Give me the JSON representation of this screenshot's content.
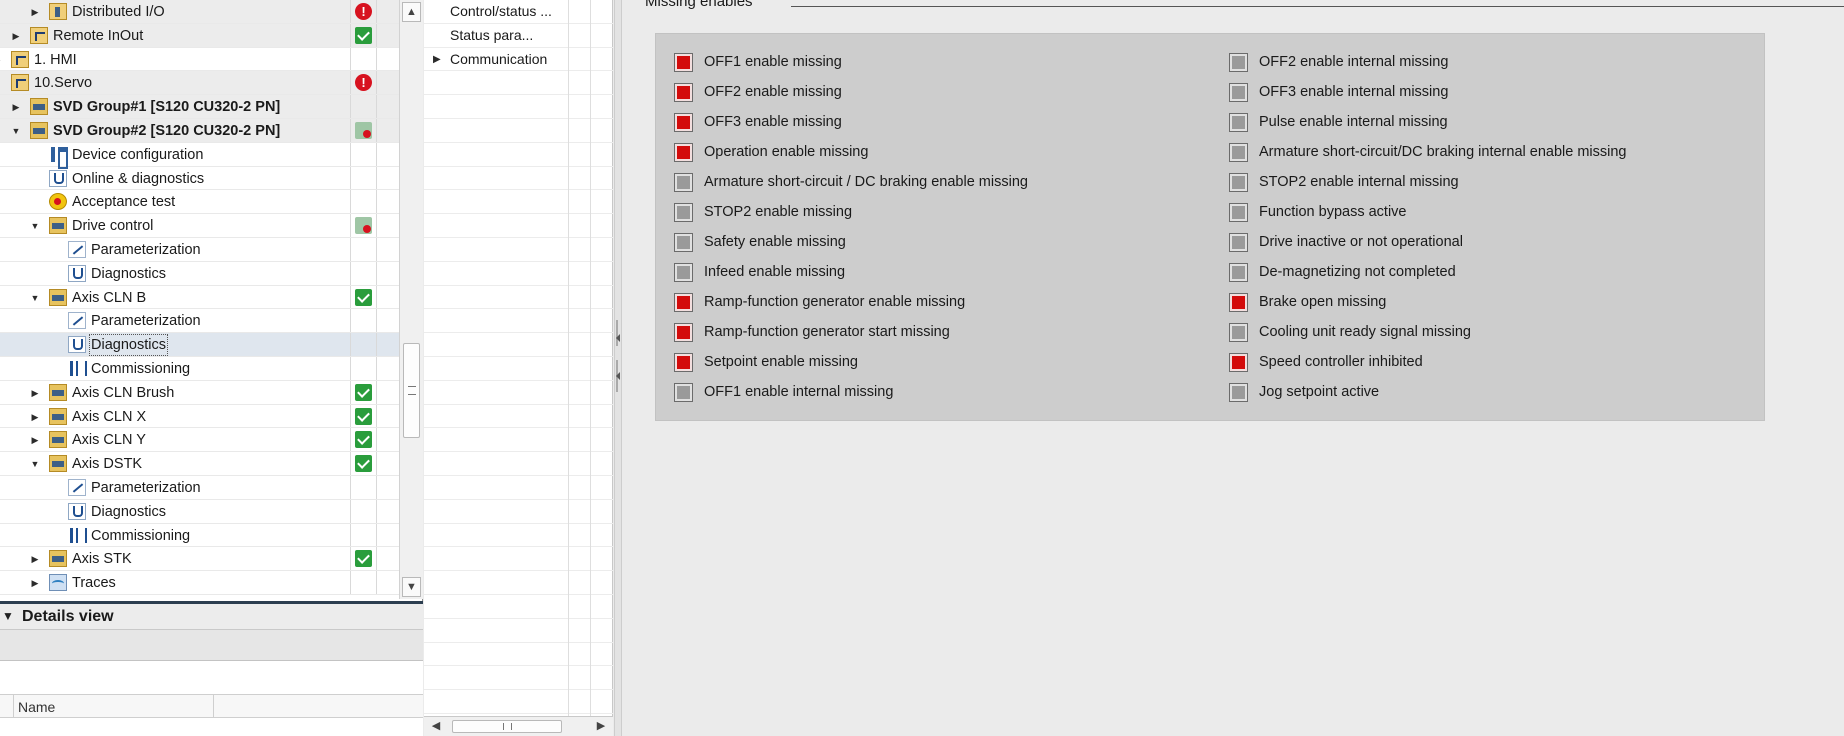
{
  "tree": {
    "rows": [
      {
        "label": "Distributed I/O",
        "indent": 3,
        "expander": "collapsed",
        "icon": "folder-io-icon",
        "status": "error",
        "bold": false
      },
      {
        "label": "Remote InOut",
        "indent": 2,
        "expander": "collapsed",
        "icon": "group-icon",
        "status": "ok",
        "bold": false
      },
      {
        "label": "1. HMI",
        "indent": 1,
        "expander": "collapsed",
        "icon": "group-icon",
        "status": "",
        "bold": false
      },
      {
        "label": "10.Servo",
        "indent": 1,
        "expander": "expanded",
        "icon": "group-icon",
        "status": "error",
        "bold": false
      },
      {
        "label": "SVD Group#1 [S120 CU320-2 PN]",
        "indent": 2,
        "expander": "collapsed",
        "icon": "drive-icon",
        "status": "",
        "bold": true
      },
      {
        "label": "SVD Group#2 [S120 CU320-2 PN]",
        "indent": 2,
        "expander": "expanded",
        "icon": "drive-icon",
        "status": "device",
        "bold": true
      },
      {
        "label": "Device configuration",
        "indent": 3,
        "expander": "",
        "icon": "device-config-icon",
        "status": "",
        "bold": false
      },
      {
        "label": "Online & diagnostics",
        "indent": 3,
        "expander": "",
        "icon": "online-diagnostics-icon",
        "status": "",
        "bold": false
      },
      {
        "label": "Acceptance test",
        "indent": 3,
        "expander": "",
        "icon": "acceptance-test-icon",
        "status": "",
        "bold": false
      },
      {
        "label": "Drive control",
        "indent": 3,
        "expander": "expanded",
        "icon": "drive-folder-icon",
        "status": "device",
        "bold": false
      },
      {
        "label": "Parameterization",
        "indent": 4,
        "expander": "",
        "icon": "parameterization-icon",
        "status": "",
        "bold": false
      },
      {
        "label": "Diagnostics",
        "indent": 4,
        "expander": "",
        "icon": "diagnostics-icon",
        "status": "",
        "bold": false
      },
      {
        "label": "Axis CLN B",
        "indent": 3,
        "expander": "expanded",
        "icon": "drive-folder-icon",
        "status": "ok",
        "bold": false
      },
      {
        "label": "Parameterization",
        "indent": 4,
        "expander": "",
        "icon": "parameterization-icon",
        "status": "",
        "bold": false
      },
      {
        "label": "Diagnostics",
        "indent": 4,
        "expander": "",
        "icon": "diagnostics-icon",
        "status": "",
        "bold": false,
        "selected": true
      },
      {
        "label": "Commissioning",
        "indent": 4,
        "expander": "",
        "icon": "commissioning-icon",
        "status": "",
        "bold": false
      },
      {
        "label": "Axis CLN Brush",
        "indent": 3,
        "expander": "collapsed",
        "icon": "drive-folder-icon",
        "status": "ok",
        "bold": false
      },
      {
        "label": "Axis CLN X",
        "indent": 3,
        "expander": "collapsed",
        "icon": "drive-folder-icon",
        "status": "ok",
        "bold": false
      },
      {
        "label": "Axis CLN Y",
        "indent": 3,
        "expander": "collapsed",
        "icon": "drive-folder-icon",
        "status": "ok",
        "bold": false
      },
      {
        "label": "Axis DSTK",
        "indent": 3,
        "expander": "expanded",
        "icon": "drive-folder-icon",
        "status": "ok",
        "bold": false
      },
      {
        "label": "Parameterization",
        "indent": 4,
        "expander": "",
        "icon": "parameterization-icon",
        "status": "",
        "bold": false
      },
      {
        "label": "Diagnostics",
        "indent": 4,
        "expander": "",
        "icon": "diagnostics-icon",
        "status": "",
        "bold": false
      },
      {
        "label": "Commissioning",
        "indent": 4,
        "expander": "",
        "icon": "commissioning-icon",
        "status": "",
        "bold": false
      },
      {
        "label": "Axis STK",
        "indent": 3,
        "expander": "collapsed",
        "icon": "drive-folder-icon",
        "status": "ok",
        "bold": false
      },
      {
        "label": "Traces",
        "indent": 3,
        "expander": "collapsed",
        "icon": "traces-icon",
        "status": "",
        "bold": false
      }
    ]
  },
  "details_view": {
    "title": "Details view",
    "column_name": "Name"
  },
  "nav": {
    "items": [
      {
        "label": "Control/status ...",
        "expander": ""
      },
      {
        "label": "Status para...",
        "expander": ""
      },
      {
        "label": "Communication",
        "expander": "collapsed"
      }
    ]
  },
  "main": {
    "section_title": "Missing enables",
    "left_column": [
      {
        "label": "OFF1 enable missing",
        "active": true
      },
      {
        "label": "OFF2 enable missing",
        "active": true
      },
      {
        "label": "OFF3 enable missing",
        "active": true
      },
      {
        "label": "Operation enable missing",
        "active": true
      },
      {
        "label": "Armature short-circuit / DC braking enable missing",
        "active": false
      },
      {
        "label": "STOP2 enable missing",
        "active": false
      },
      {
        "label": "Safety enable missing",
        "active": false
      },
      {
        "label": "Infeed enable missing",
        "active": false
      },
      {
        "label": "Ramp-function generator enable missing",
        "active": true
      },
      {
        "label": "Ramp-function generator start missing",
        "active": true
      },
      {
        "label": "Setpoint enable missing",
        "active": true
      },
      {
        "label": "OFF1 enable internal missing",
        "active": false
      }
    ],
    "right_column": [
      {
        "label": "OFF2 enable internal missing",
        "active": false
      },
      {
        "label": "OFF3 enable internal missing",
        "active": false
      },
      {
        "label": "Pulse enable internal missing",
        "active": false
      },
      {
        "label": "Armature short-circuit/DC braking internal enable missing",
        "active": false
      },
      {
        "label": "STOP2 enable internal missing",
        "active": false
      },
      {
        "label": "Function bypass active",
        "active": false
      },
      {
        "label": "Drive inactive or not operational",
        "active": false
      },
      {
        "label": "De-magnetizing not completed",
        "active": false
      },
      {
        "label": "Brake open missing",
        "active": true
      },
      {
        "label": "Cooling unit ready signal missing",
        "active": false
      },
      {
        "label": "Speed controller inhibited",
        "active": true
      },
      {
        "label": "Jog setpoint active",
        "active": false
      }
    ]
  },
  "colors": {
    "led_active": "#d30b0b",
    "led_inactive": "#9a9a9a",
    "status_ok": "#2a9d3c",
    "status_error": "#d7121f"
  }
}
